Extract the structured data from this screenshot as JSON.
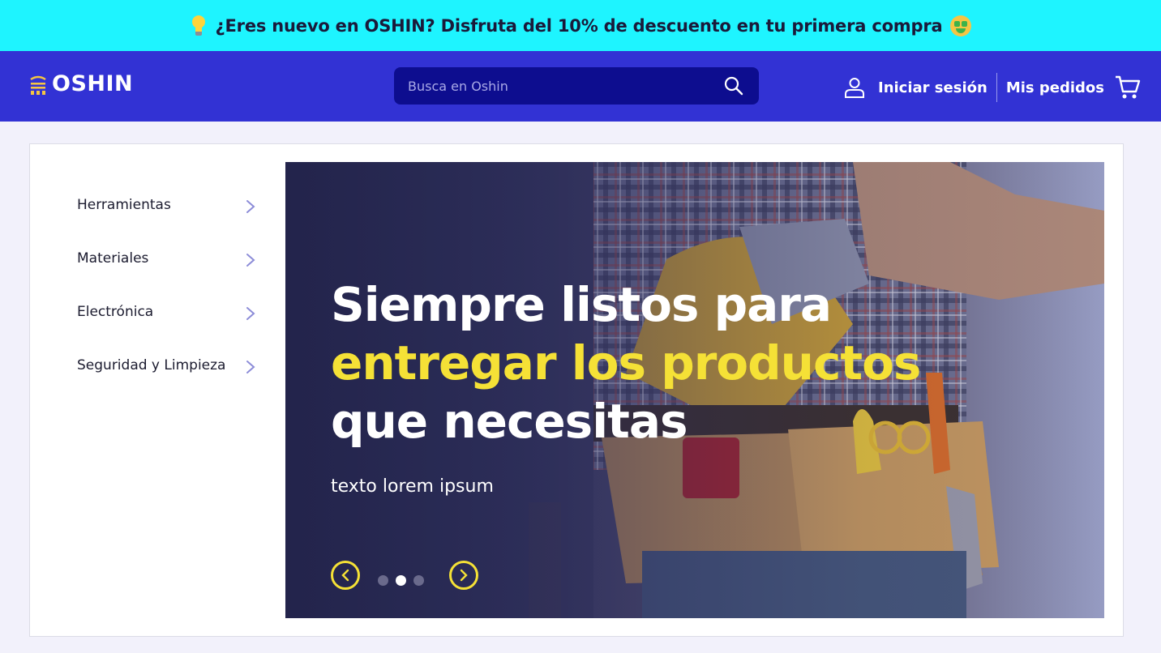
{
  "promo": {
    "text": "¿Eres nuevo en OSHIN? Disfruta del 10% de descuento en tu primera compra",
    "left_icon": "light-bulb-icon",
    "right_icon": "money-mouth-face-icon"
  },
  "header": {
    "logo_text": "OSHIN",
    "search_placeholder": "Busca en Oshin",
    "login_label": "Iniciar sesión",
    "orders_label": "Mis pedidos",
    "icons": [
      "search-icon",
      "user-icon",
      "cart-icon"
    ]
  },
  "categories": [
    {
      "label": "Herramientas"
    },
    {
      "label": "Materiales"
    },
    {
      "label": "Electrónica"
    },
    {
      "label": "Seguridad y Limpieza"
    }
  ],
  "hero": {
    "title_line1": "Siempre listos para",
    "title_accent": "entregar los productos",
    "title_line3": "que necesitas",
    "subtitle": "texto lorem ipsum",
    "slide_count": 3,
    "active_slide": 2
  },
  "colors": {
    "promo_bg": "#1ef4ff",
    "header_bg": "#3232d4",
    "search_bg": "#0d0d8f",
    "accent_yellow": "#f5e136"
  }
}
